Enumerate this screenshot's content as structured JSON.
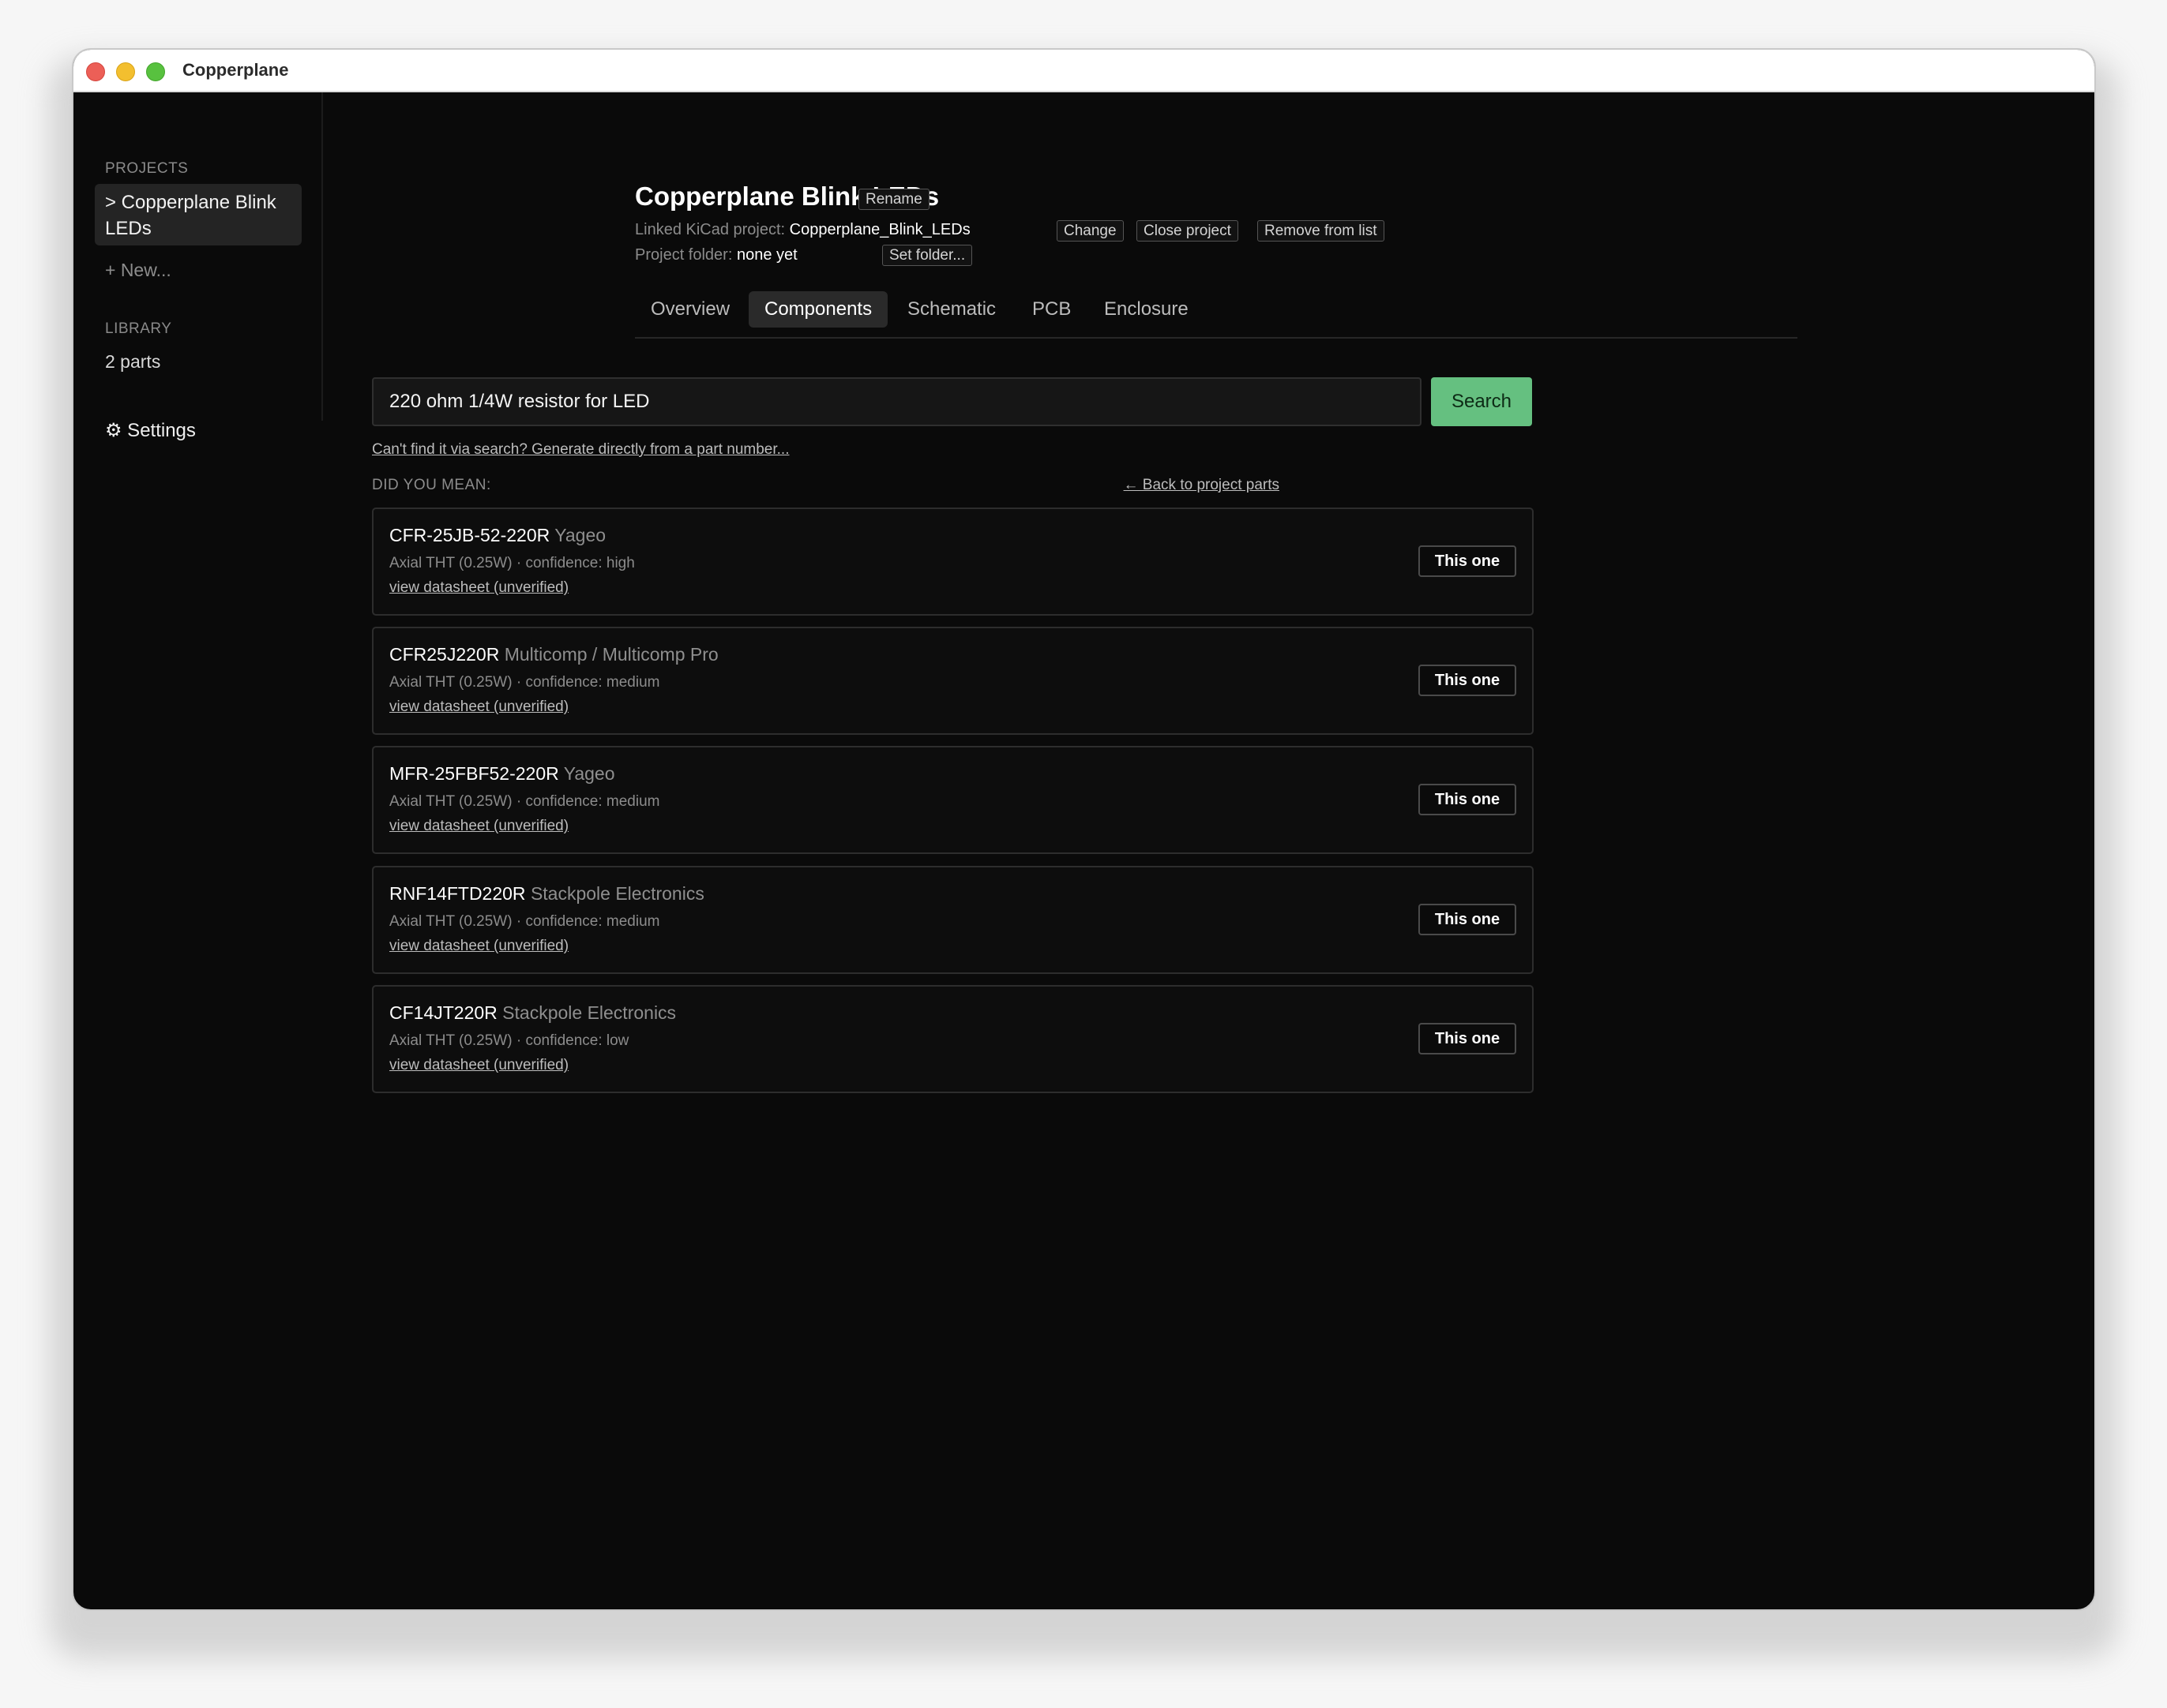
{
  "window": {
    "title": "Copperplane"
  },
  "sidebar": {
    "projects_heading": "PROJECTS",
    "active_project": "> Copperplane Blink LEDs",
    "new_link": "+ New...",
    "library_heading": "LIBRARY",
    "library_count": "2 parts",
    "settings": "⚙ Settings"
  },
  "project": {
    "title": "Copperplane Blink LEDs",
    "rename_label": "Rename",
    "linked_label": "Linked KiCad project:",
    "linked_value": "Copperplane_Blink_LEDs",
    "change_label": "Change",
    "close_label": "Close project",
    "remove_label": "Remove from list",
    "folder_label": "Project folder:",
    "folder_value": "none yet",
    "set_folder_label": "Set folder..."
  },
  "tabs": [
    "Overview",
    "Components",
    "Schematic",
    "PCB",
    "Enclosure"
  ],
  "active_tab": "Components",
  "search": {
    "value": "220 ohm 1/4W resistor for LED",
    "button": "Search",
    "generate_link": "Can't find it via search? Generate directly from a part number...",
    "did_you_mean": "DID YOU MEAN:",
    "back_link": "← Back to project parts"
  },
  "results": [
    {
      "part": "CFR-25JB-52-220R",
      "mfr": "Yageo",
      "desc": "Axial THT (0.25W) · confidence: high",
      "datasheet": "view datasheet (unverified)",
      "button": "This one"
    },
    {
      "part": "CFR25J220R",
      "mfr": "Multicomp / Multicomp Pro",
      "desc": "Axial THT (0.25W) · confidence: medium",
      "datasheet": "view datasheet (unverified)",
      "button": "This one"
    },
    {
      "part": "MFR-25FBF52-220R",
      "mfr": "Yageo",
      "desc": "Axial THT (0.25W) · confidence: medium",
      "datasheet": "view datasheet (unverified)",
      "button": "This one"
    },
    {
      "part": "RNF14FTD220R",
      "mfr": "Stackpole Electronics",
      "desc": "Axial THT (0.25W) · confidence: medium",
      "datasheet": "view datasheet (unverified)",
      "button": "This one"
    },
    {
      "part": "CF14JT220R",
      "mfr": "Stackpole Electronics",
      "desc": "Axial THT (0.25W) · confidence: low",
      "datasheet": "view datasheet (unverified)",
      "button": "This one"
    }
  ]
}
